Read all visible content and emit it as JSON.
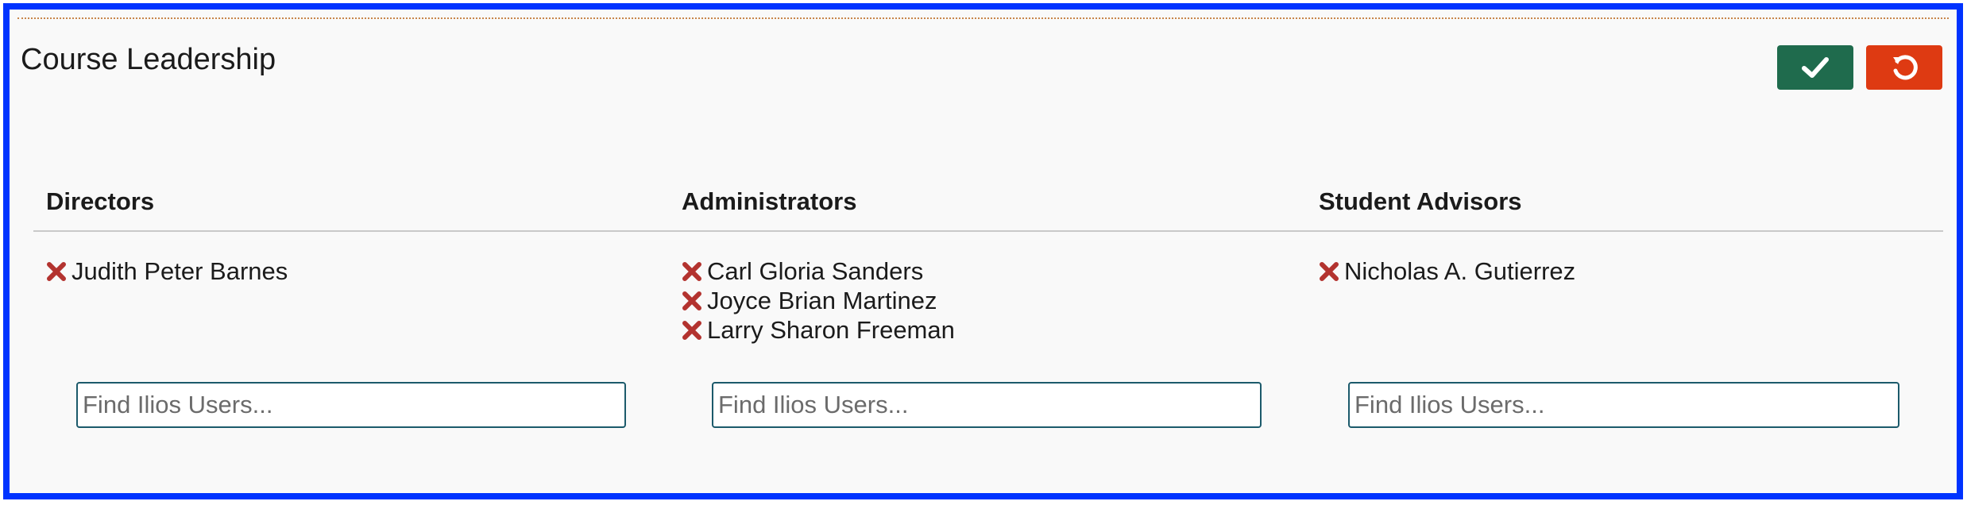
{
  "section": {
    "title": "Course Leadership",
    "save_icon": "checkmark-icon",
    "cancel_icon": "undo-icon",
    "colors": {
      "save": "#1f6b4d",
      "cancel": "#de3a12",
      "remove": "#b3332f",
      "frame": "#0033ff"
    }
  },
  "columns": [
    {
      "header": "Directors",
      "users": [
        "Judith Peter Barnes"
      ],
      "search_placeholder": "Find Ilios Users..."
    },
    {
      "header": "Administrators",
      "users": [
        "Carl Gloria Sanders",
        "Joyce Brian Martinez",
        "Larry Sharon Freeman"
      ],
      "search_placeholder": "Find Ilios Users..."
    },
    {
      "header": "Student Advisors",
      "users": [
        "Nicholas A. Gutierrez"
      ],
      "search_placeholder": "Find Ilios Users..."
    }
  ]
}
